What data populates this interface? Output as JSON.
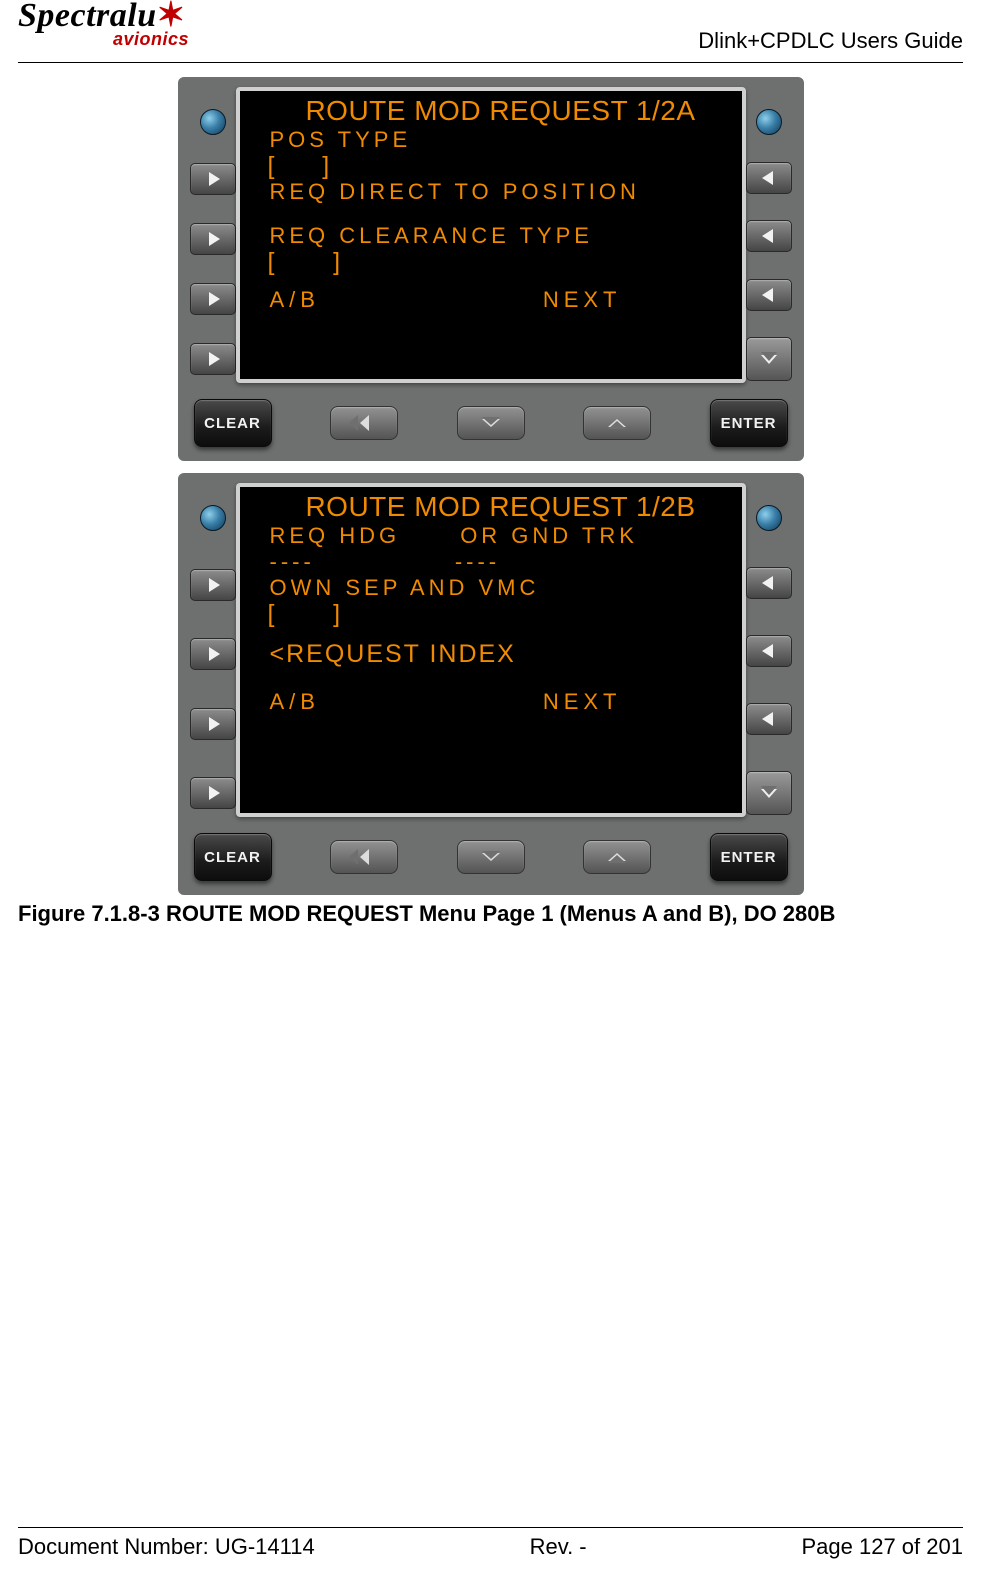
{
  "header": {
    "brand_main": "Spectralu",
    "brand_star": "✶",
    "brand_tag": "avionics",
    "doc_title": "Dlink+CPDLC Users Guide"
  },
  "buttons": {
    "clear": "CLEAR",
    "enter": "ENTER"
  },
  "screenA": {
    "title": "ROUTE MOD REQUEST 1/2A",
    "l1": "POS TYPE",
    "l2": "[    ]",
    "l3": "REQ DIRECT TO POSITION",
    "l4": "REQ CLEARANCE TYPE",
    "l5": "[     ]",
    "bl": "A/B",
    "br": "NEXT"
  },
  "screenB": {
    "title": "ROUTE MOD REQUEST 1/2B",
    "r1a": "REQ HDG",
    "r1b": "OR GND TRK",
    "r2a": "----",
    "r2b": "----",
    "l3": "OWN SEP AND VMC",
    "l4": "[     ]",
    "l5": "<REQUEST INDEX",
    "bl": "A/B",
    "br": "NEXT"
  },
  "caption": "Figure 7.1.8-3 ROUTE MOD REQUEST Menu Page 1 (Menus A and B), DO 280B",
  "footer": {
    "left": "Document Number:  UG-14114",
    "mid": "Rev. -",
    "right": "Page 127 of 201"
  }
}
